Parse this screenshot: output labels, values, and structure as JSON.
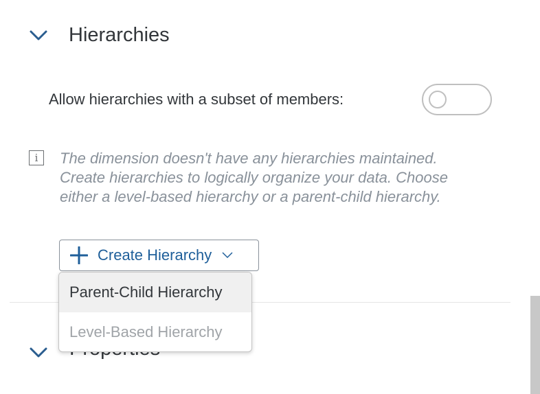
{
  "hierarchies_section": {
    "title": "Hierarchies",
    "expand_icon": "chevron-down-icon"
  },
  "allow_subset": {
    "label": "Allow hierarchies with a subset of members:",
    "toggle_state": "off"
  },
  "info": {
    "icon": "info-icon",
    "icon_glyph": "i",
    "text": "The dimension doesn't have any hierarchies maintained. Create hierarchies to logically organize your data. Choose either a level-based hierarchy or a parent-child hierarchy."
  },
  "create_button": {
    "label": "Create Hierarchy",
    "icon": "plus-icon",
    "caret_icon": "chevron-down-icon"
  },
  "dropdown_menu": {
    "items": [
      {
        "label": "Parent-Child Hierarchy",
        "state": "hovered"
      },
      {
        "label": "Level-Based Hierarchy",
        "state": "disabled"
      }
    ]
  },
  "properties_section": {
    "title": "Properties",
    "expand_icon": "chevron-down-icon"
  },
  "colors": {
    "accent": "#1f5f9a",
    "text": "#32363a",
    "muted_text": "#89919a"
  }
}
